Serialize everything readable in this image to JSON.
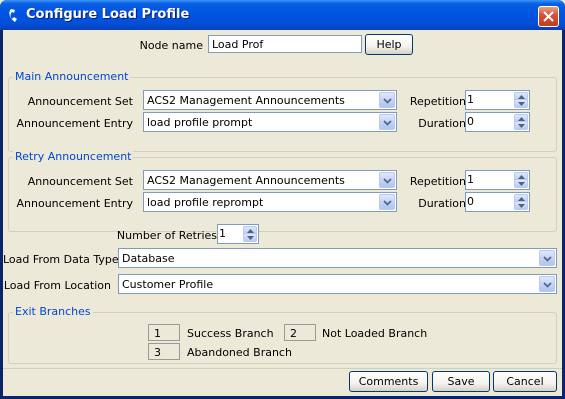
{
  "window": {
    "title": "Configure Load Profile"
  },
  "node": {
    "label": "Node name",
    "value": "Load Prof",
    "help_label": "Help"
  },
  "main_announcement": {
    "title": "Main Announcement",
    "set_label": "Announcement Set",
    "set_value": "ACS2 Management Announcements",
    "entry_label": "Announcement Entry",
    "entry_value": "load profile prompt",
    "repetition_label": "Repetition",
    "repetition_value": "1",
    "duration_label": "Duration",
    "duration_value": "0"
  },
  "retry_announcement": {
    "title": "Retry Announcement",
    "set_label": "Announcement Set",
    "set_value": "ACS2 Management Announcements",
    "entry_label": "Announcement Entry",
    "entry_value": "load profile reprompt",
    "repetition_label": "Repetition",
    "repetition_value": "1",
    "duration_label": "Duration",
    "duration_value": "0"
  },
  "retries": {
    "label": "Number of Retries",
    "value": "1"
  },
  "data_type": {
    "label": "Load From Data Type",
    "value": "Database"
  },
  "location": {
    "label": "Load From Location",
    "value": "Customer Profile"
  },
  "exit_branches": {
    "title": "Exit Branches",
    "items": [
      {
        "num": "1",
        "label": "Success Branch"
      },
      {
        "num": "2",
        "label": "Not Loaded Branch"
      },
      {
        "num": "3",
        "label": "Abandoned Branch"
      }
    ]
  },
  "footer": {
    "comments_label": "Comments",
    "save_label": "Save",
    "cancel_label": "Cancel"
  },
  "colors": {
    "title_bar": "#0054e3",
    "group_title": "#0046d5",
    "dialog_bg": "#ece9d8",
    "close_button": "#d4553a"
  }
}
